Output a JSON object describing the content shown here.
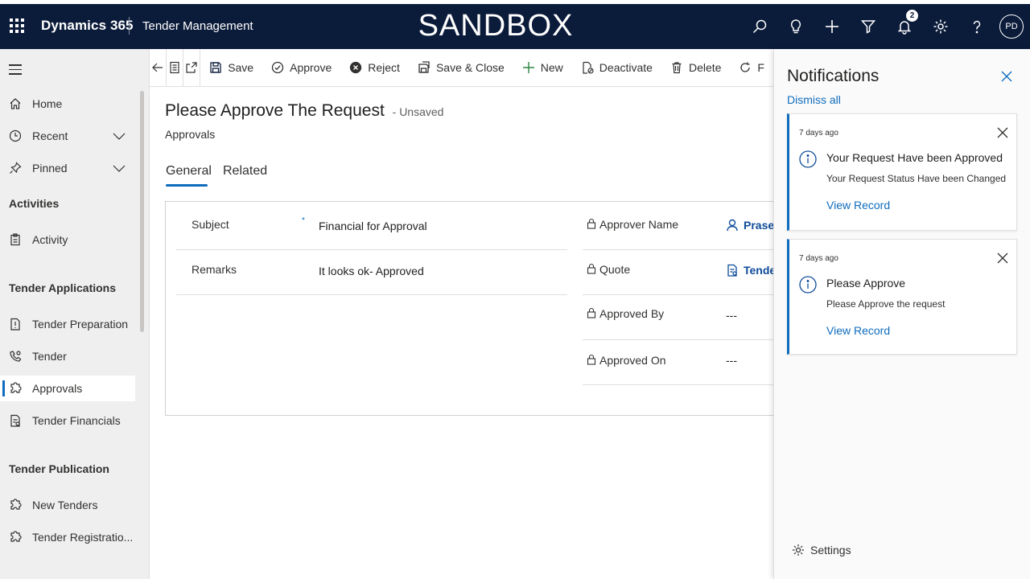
{
  "topbar": {
    "brand": "Dynamics 365",
    "app_name": "Tender Management",
    "environment": "SANDBOX",
    "notification_count": "2",
    "user_initials": "PD"
  },
  "nav": {
    "items_top": [
      {
        "label": "Home",
        "icon": "home-icon"
      },
      {
        "label": "Recent",
        "icon": "clock-icon"
      },
      {
        "label": "Pinned",
        "icon": "pin-icon"
      }
    ],
    "groups": {
      "activities": "Activities",
      "tender_applications": "Tender Applications",
      "tender_publication": "Tender Publication"
    },
    "activity": "Activity",
    "tender_preparation": "Tender Preparation",
    "tender": "Tender",
    "approvals": "Approvals",
    "tender_financials": "Tender Financials",
    "new_tenders": "New Tenders",
    "tender_registration": "Tender Registratio..."
  },
  "commands": {
    "save": "Save",
    "approve": "Approve",
    "reject": "Reject",
    "save_close": "Save & Close",
    "new": "New",
    "deactivate": "Deactivate",
    "delete": "Delete",
    "more": "F"
  },
  "form": {
    "title": "Please Approve The Request",
    "status": "- Unsaved",
    "entity": "Approvals",
    "tabs": {
      "general": "General",
      "related": "Related"
    },
    "fields": {
      "subject_label": "Subject",
      "subject_value": "Financial for Approval",
      "remarks_label": "Remarks",
      "remarks_value": "It looks ok- Approved",
      "approver_name_label": "Approver Name",
      "approver_name_value": "Prasen",
      "quote_label": "Quote",
      "quote_value": "Tender",
      "approved_by_label": "Approved By",
      "approved_by_value": "---",
      "approved_on_label": "Approved On",
      "approved_on_value": "---",
      "required_marker": "*"
    }
  },
  "notifications": {
    "title": "Notifications",
    "dismiss_all": "Dismiss all",
    "cards": [
      {
        "time": "7 days ago",
        "title": "Your Request Have been Approved",
        "body": "Your Request Status Have been Changed",
        "link": "View Record"
      },
      {
        "time": "7 days ago",
        "title": "Please Approve",
        "body": "Please Approve the request",
        "link": "View Record"
      }
    ],
    "settings": "Settings"
  },
  "colors": {
    "topbar": "#0b1b3a",
    "accent": "#0f6cbd",
    "nav_bg": "#efefef"
  }
}
